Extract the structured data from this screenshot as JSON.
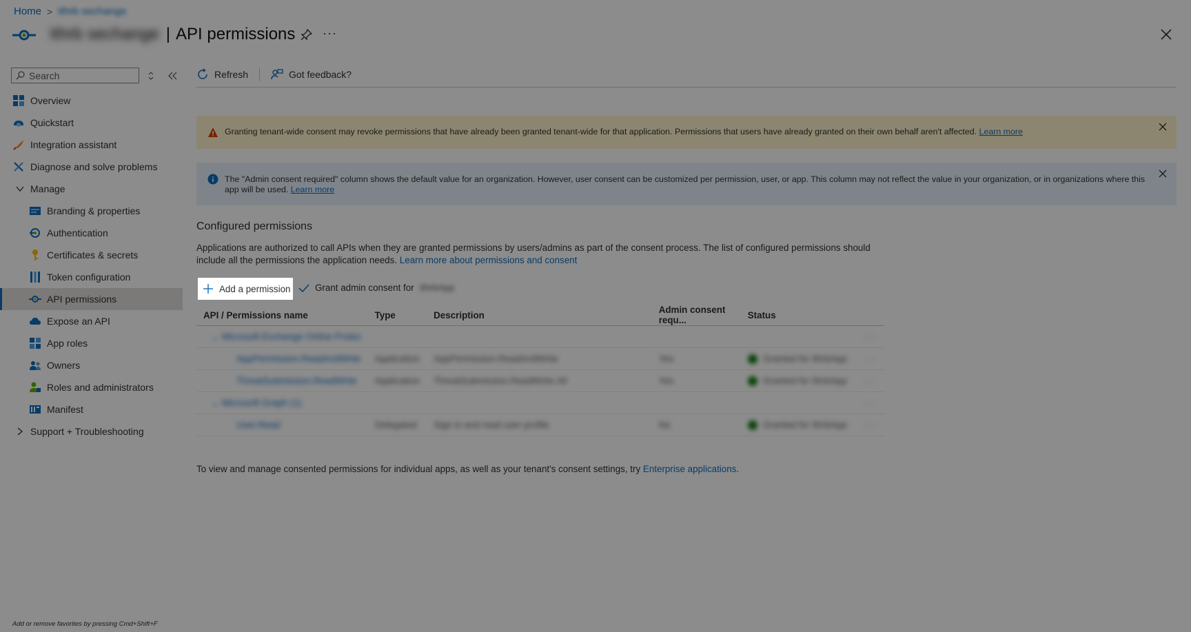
{
  "breadcrumb": {
    "home": "Home",
    "current": "Ithrb sechange"
  },
  "header": {
    "app_name": "Ithrb sechange",
    "separator": "|",
    "title": "API permissions",
    "more": "···"
  },
  "sidebar": {
    "search_placeholder": "Search",
    "items": [
      {
        "label": "Overview",
        "icon": "overview-icon"
      },
      {
        "label": "Quickstart",
        "icon": "quickstart-icon"
      },
      {
        "label": "Integration assistant",
        "icon": "rocket-icon"
      },
      {
        "label": "Diagnose and solve problems",
        "icon": "wrench-icon"
      },
      {
        "label": "Manage",
        "icon": "chevron-down-icon"
      },
      {
        "label": "Branding & properties",
        "icon": "branding-icon"
      },
      {
        "label": "Authentication",
        "icon": "auth-icon"
      },
      {
        "label": "Certificates & secrets",
        "icon": "key-icon"
      },
      {
        "label": "Token configuration",
        "icon": "token-icon"
      },
      {
        "label": "API permissions",
        "icon": "api-permissions-icon"
      },
      {
        "label": "Expose an API",
        "icon": "cloud-icon"
      },
      {
        "label": "App roles",
        "icon": "app-roles-icon"
      },
      {
        "label": "Owners",
        "icon": "owners-icon"
      },
      {
        "label": "Roles and administrators",
        "icon": "roles-icon"
      },
      {
        "label": "Manifest",
        "icon": "manifest-icon"
      },
      {
        "label": "Support + Troubleshooting",
        "icon": "chevron-right-icon"
      }
    ]
  },
  "toolbar": {
    "refresh": "Refresh",
    "feedback": "Got feedback?"
  },
  "warning_banner": {
    "text": "Granting tenant-wide consent may revoke permissions that have already been granted tenant-wide for that application. Permissions that users have already granted on their own behalf aren't affected.",
    "link": "Learn more"
  },
  "info_banner": {
    "text": "The \"Admin consent required\" column shows the default value for an organization. However, user consent can be customized per permission, user, or app. This column may not reflect the value in your organization, or in organizations where this app will be used.",
    "link": "Learn more"
  },
  "configured": {
    "title": "Configured permissions",
    "description": "Applications are authorized to call APIs when they are granted permissions by users/admins as part of the consent process. The list of configured permissions should include all the permissions the application needs.",
    "link": "Learn more about permissions and consent",
    "add_button": "Add a permission",
    "grant_button": "Grant admin consent for",
    "grant_org": "IthrbApp"
  },
  "table": {
    "headers": [
      "API / Permissions name",
      "Type",
      "Description",
      "Admin consent requ...",
      "Status"
    ],
    "rows": [
      {
        "kind": "group",
        "name": "Microsoft Exchange Online Protec",
        "type": "",
        "desc": "",
        "admin": "",
        "status": ""
      },
      {
        "kind": "perm",
        "name": "AppPermission.ReadAndWrite",
        "type": "Application",
        "desc": "AppPermission.ReadAndWrite",
        "admin": "Yes",
        "status": "Granted for IthrbApp"
      },
      {
        "kind": "perm",
        "name": "ThreatSubmission.ReadWrite",
        "type": "Application",
        "desc": "ThreatSubmission.ReadWrite.All",
        "admin": "Yes",
        "status": "Granted for IthrbApp"
      },
      {
        "kind": "group",
        "name": "Microsoft Graph (1)",
        "type": "",
        "desc": "",
        "admin": "",
        "status": ""
      },
      {
        "kind": "perm",
        "name": "User.Read",
        "type": "Delegated",
        "desc": "Sign in and read user profile",
        "admin": "No",
        "status": "Granted for IthrbApp"
      }
    ]
  },
  "footer": {
    "text": "To view and manage consented permissions for individual apps, as well as your tenant's consent settings, try",
    "link": "Enterprise applications",
    "period": "."
  },
  "fav_hint": "Add or remove favorites by pressing Cmd+Shift+F",
  "colors": {
    "accent": "#0f6cbd",
    "warning_bg": "#fff4ce",
    "info_bg": "#e8f1fb",
    "granted": "#107c10"
  }
}
